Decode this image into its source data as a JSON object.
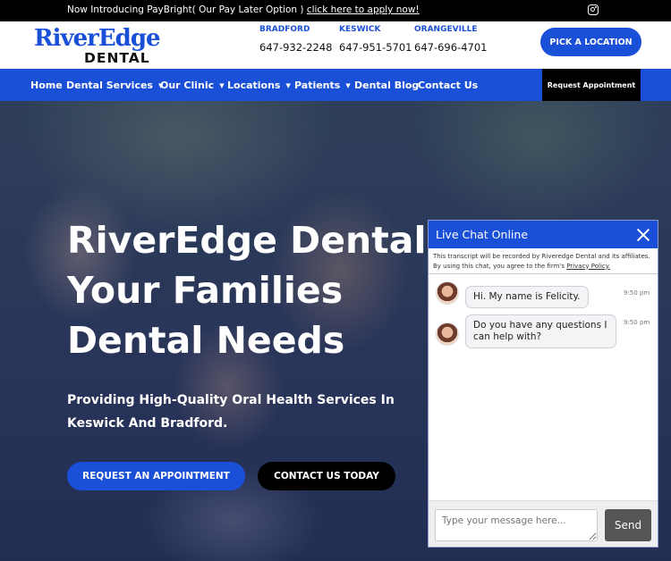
{
  "topbar": {
    "promo_text": "Now Introducing PayBright( Our Pay Later Option ) ",
    "promo_link": "click here to apply now!",
    "social_icon": "instagram-icon"
  },
  "header": {
    "logo_river": "RiverEdge",
    "logo_dental": "DENTAL",
    "locations": [
      {
        "city": "BRADFORD",
        "phone": "647-932-2248"
      },
      {
        "city": "KESWICK",
        "phone": "647-951-5701"
      },
      {
        "city": "ORANGEVILLE",
        "phone": "647-696-4701"
      }
    ],
    "pick_location": "PICK A LOCATION"
  },
  "nav": {
    "items": [
      {
        "label": "Home"
      },
      {
        "label": "Dental Services"
      },
      {
        "label": "Our Clinic"
      },
      {
        "label": "Locations"
      },
      {
        "label": "Patients"
      },
      {
        "label": "Dental Blog"
      },
      {
        "label": "Contact Us"
      }
    ],
    "caret": "▼",
    "request_appointment": "Request Appointment"
  },
  "hero": {
    "title": "RiverEdge Dental Your Families Dental Needs",
    "subtitle": "Providing High-Quality Oral Health Services In Keswick And Bradford.",
    "request_button": "REQUEST AN APPOINTMENT",
    "contact_button": "CONTACT US TODAY"
  },
  "chat": {
    "title": "Live Chat Online",
    "notice": "This transcript will be recorded by Riveredge Dental and its affiliates. By using this chat, you agree to the firm's ",
    "privacy_link": "Privacy Policy.",
    "messages": [
      {
        "text": "Hi. My name is Felicity.",
        "time": "9:50 pm"
      },
      {
        "text": "Do you have any questions I can help with?",
        "time": "9:50 pm"
      }
    ],
    "input_placeholder": "Type your message here...",
    "send_label": "Send"
  },
  "colors": {
    "brand_blue": "#1a4fd8",
    "black": "#000000"
  }
}
